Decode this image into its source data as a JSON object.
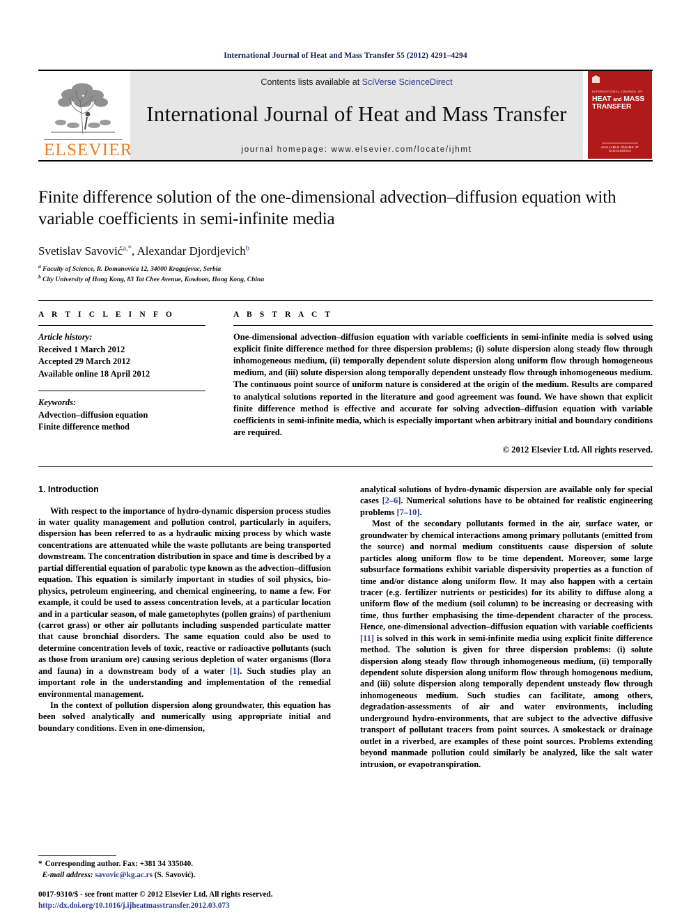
{
  "running_head": "International Journal of Heat and Mass Transfer 55 (2012) 4291–4294",
  "masthead": {
    "contents_prefix": "Contents lists available at ",
    "sciencedirect": "SciVerse ScienceDirect",
    "journal_title": "International Journal of Heat and Mass Transfer",
    "homepage": "journal homepage: www.elsevier.com/locate/ijhmt",
    "publisher": "ELSEVIER",
    "cover": {
      "kicker": "INTERNATIONAL JOURNAL OF",
      "line1": "HEAT",
      "and": "and",
      "line2": "MASS",
      "line3": "TRANSFER",
      "footer_small": "AVAILABLE ONLINE AT",
      "footer": "ScienceDirect",
      "color": "#b01a19"
    }
  },
  "article": {
    "title": "Finite difference solution of the one-dimensional advection–diffusion equation with variable coefficients in semi-infinite media",
    "authors": [
      {
        "name": "Svetislav Savović",
        "marks": "a,*"
      },
      {
        "name": "Alexandar Djordjevich",
        "marks": "b"
      }
    ],
    "affiliations": [
      {
        "mark": "a",
        "text": "Faculty of Science, R. Domanovića 12, 34000 Kragujevac, Serbia"
      },
      {
        "mark": "b",
        "text": "City University of Hong Kong, 83 Tat Chee Avenue, Kowloon, Hong Kong, China"
      }
    ]
  },
  "article_info": {
    "heading": "A R T I C L E    I N F O",
    "history_label": "Article history:",
    "history": [
      "Received 1 March 2012",
      "Accepted 29 March 2012",
      "Available online 18 April 2012"
    ],
    "keywords_label": "Keywords:",
    "keywords": [
      "Advection–diffusion equation",
      "Finite difference method"
    ]
  },
  "abstract": {
    "heading": "A B S T R A C T",
    "text": "One-dimensional advection–diffusion equation with variable coefficients in semi-infinite media is solved using explicit finite difference method for three dispersion problems; (i) solute dispersion along steady flow through inhomogeneous medium, (ii) temporally dependent solute dispersion along uniform flow through homogeneous medium, and (iii) solute dispersion along temporally dependent unsteady flow through inhomogeneous medium. The continuous point source of uniform nature is considered at the origin of the medium. Results are compared to analytical solutions reported in the literature and good agreement was found. We have shown that explicit finite difference method is effective and accurate for solving advection–diffusion equation with variable coefficients in semi-infinite media, which is especially important when arbitrary initial and boundary conditions are required.",
    "copyright": "© 2012 Elsevier Ltd. All rights reserved."
  },
  "body": {
    "section_title": "1. Introduction",
    "left_p1_a": "With respect to the importance of hydro-dynamic dispersion process studies in water quality management and pollution control, particularly in aquifers, dispersion has been referred to as a hydraulic mixing process by which waste concentrations are attenuated while the waste pollutants are being transported downstream. The concentration distribution in space and time is described by a partial differential equation of parabolic type known as the advection–diffusion equation. This equation is similarly important in studies of soil physics, bio-physics, petroleum engineering, and chemical engineering, to name a few. For example, it could be used to assess concentration levels, at a particular location and in a particular season, of male gametophytes (pollen grains) of parthenium (carrot grass) or other air pollutants including suspended particulate matter that cause bronchial disorders. The same equation could also be used to determine concentration levels of toxic, reactive or radioactive pollutants (such as those from uranium ore) causing serious depletion of water organisms (flora and fauna) in a downstream body of a water ",
    "left_p1_ref": "[1]",
    "left_p1_b": ". Such studies play an important role in the understanding and implementation of the remedial environmental management.",
    "left_p2": "In the context of pollution dispersion along groundwater, this equation has been solved analytically and numerically using appropriate initial and boundary conditions. Even in one-dimension,",
    "right_p1_a": "analytical solutions of hydro-dynamic dispersion are available only for special cases ",
    "right_p1_ref1": "[2–6]",
    "right_p1_b": ". Numerical solutions have to be obtained for realistic engineering problems ",
    "right_p1_ref2": "[7–10]",
    "right_p1_c": ".",
    "right_p2_a": "Most of the secondary pollutants formed in the air, surface water, or groundwater by chemical interactions among primary pollutants (emitted from the source) and normal medium constituents cause dispersion of solute particles along uniform flow to be time dependent. Moreover, some large subsurface formations exhibit variable dispersivity properties as a function of time and/or distance along uniform flow. It may also happen with a certain tracer (e.g. fertilizer nutrients or pesticides) for its ability to diffuse along a uniform flow of the medium (soil column) to be increasing or decreasing with time, thus further emphasising the time-dependent character of the process. Hence, one-dimensional advection–diffusion equation with variable coefficients ",
    "right_p2_ref": "[11]",
    "right_p2_b": " is solved in this work in semi-infinite media using explicit finite difference method. The solution is given for three dispersion problems: (i) solute dispersion along steady flow through inhomogeneous medium, (ii) temporally dependent solute dispersion along uniform flow through homogenous medium, and (iii) solute dispersion along temporally dependent unsteady flow through inhomogeneous medium. Such studies can facilitate, among others, degradation-assessments of air and water environments, including underground hydro-environments, that are subject to the advective diffusive transport of pollutant tracers from point sources. A smokestack or drainage outlet in a riverbed, are examples of these point sources. Problems extending beyond manmade pollution could similarly be analyzed, like the salt water intrusion, or evapotranspiration."
  },
  "footnote": {
    "corresponding": "Corresponding author. Fax: +381 34 335040.",
    "email_label": "E-mail address:",
    "email": "savovic@kg.ac.rs",
    "email_owner": "(S. Savović)."
  },
  "imprint": {
    "issn_line": "0017-9310/$ - see front matter © 2012 Elsevier Ltd. All rights reserved.",
    "doi": "http://dx.doi.org/10.1016/j.ijheatmasstransfer.2012.03.073"
  }
}
